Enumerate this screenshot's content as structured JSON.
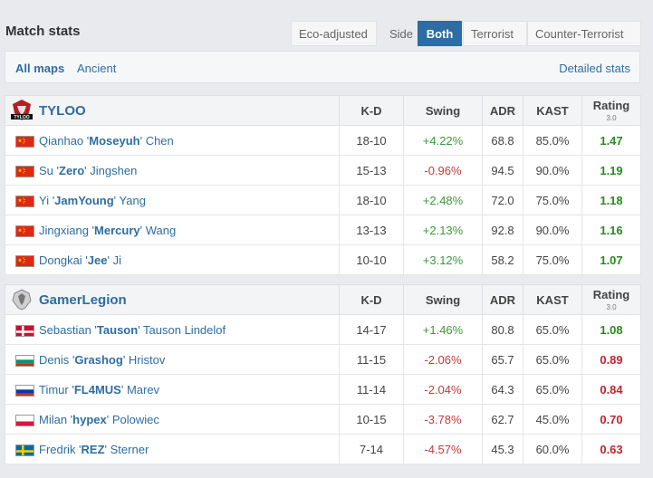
{
  "header": {
    "title": "Match stats",
    "eco_label": "Eco-adjusted",
    "side_label": "Side",
    "side_options": [
      "Both",
      "Terrorist",
      "Counter-Terrorist"
    ],
    "selected_side": "Both"
  },
  "maps": {
    "items": [
      "All maps",
      "Ancient"
    ],
    "selected": "All maps",
    "detailed_link": "Detailed stats"
  },
  "columns": {
    "kd": "K-D",
    "swing": "Swing",
    "adr": "ADR",
    "kast": "KAST",
    "rating": "Rating",
    "rating_sub": "3.0"
  },
  "colors": {
    "accent": "#2d6da3",
    "positive": "#3a9a3a",
    "negative": "#c23a3a"
  },
  "teams": [
    {
      "name": "TYLOO",
      "logo_icon": "tyloo-logo-icon",
      "players": [
        {
          "first": "Qianhao '",
          "nick": "Moseyuh",
          "last": "' Chen",
          "flag": "china",
          "kd": "18-10",
          "swing": "+4.22%",
          "adr": "68.8",
          "kast": "85.0%",
          "rating": "1.47"
        },
        {
          "first": "Su '",
          "nick": "Zero",
          "last": "' Jingshen",
          "flag": "china",
          "kd": "15-13",
          "swing": "-0.96%",
          "adr": "94.5",
          "kast": "90.0%",
          "rating": "1.19"
        },
        {
          "first": "Yi '",
          "nick": "JamYoung",
          "last": "' Yang",
          "flag": "china",
          "kd": "18-10",
          "swing": "+2.48%",
          "adr": "72.0",
          "kast": "75.0%",
          "rating": "1.18"
        },
        {
          "first": "Jingxiang '",
          "nick": "Mercury",
          "last": "' Wang",
          "flag": "china",
          "kd": "13-13",
          "swing": "+2.13%",
          "adr": "92.8",
          "kast": "90.0%",
          "rating": "1.16"
        },
        {
          "first": "Dongkai '",
          "nick": "Jee",
          "last": "' Ji",
          "flag": "china",
          "kd": "10-10",
          "swing": "+3.12%",
          "adr": "58.2",
          "kast": "75.0%",
          "rating": "1.07"
        }
      ]
    },
    {
      "name": "GamerLegion",
      "logo_icon": "gamerlegion-logo-icon",
      "players": [
        {
          "first": "Sebastian '",
          "nick": "Tauson",
          "last": "' Tauson Lindelof",
          "flag": "denmark",
          "kd": "14-17",
          "swing": "+1.46%",
          "adr": "80.8",
          "kast": "65.0%",
          "rating": "1.08"
        },
        {
          "first": "Denis '",
          "nick": "Grashog",
          "last": "' Hristov",
          "flag": "bulgaria",
          "kd": "11-15",
          "swing": "-2.06%",
          "adr": "65.7",
          "kast": "65.0%",
          "rating": "0.89"
        },
        {
          "first": "Timur '",
          "nick": "FL4MUS",
          "last": "' Marev",
          "flag": "russia",
          "kd": "11-14",
          "swing": "-2.04%",
          "adr": "64.3",
          "kast": "65.0%",
          "rating": "0.84"
        },
        {
          "first": "Milan '",
          "nick": "hypex",
          "last": "' Polowiec",
          "flag": "poland",
          "kd": "10-15",
          "swing": "-3.78%",
          "adr": "62.7",
          "kast": "45.0%",
          "rating": "0.70"
        },
        {
          "first": "Fredrik '",
          "nick": "REZ",
          "last": "' Sterner",
          "flag": "sweden",
          "kd": "7-14",
          "swing": "-4.57%",
          "adr": "45.3",
          "kast": "60.0%",
          "rating": "0.63"
        }
      ]
    }
  ]
}
